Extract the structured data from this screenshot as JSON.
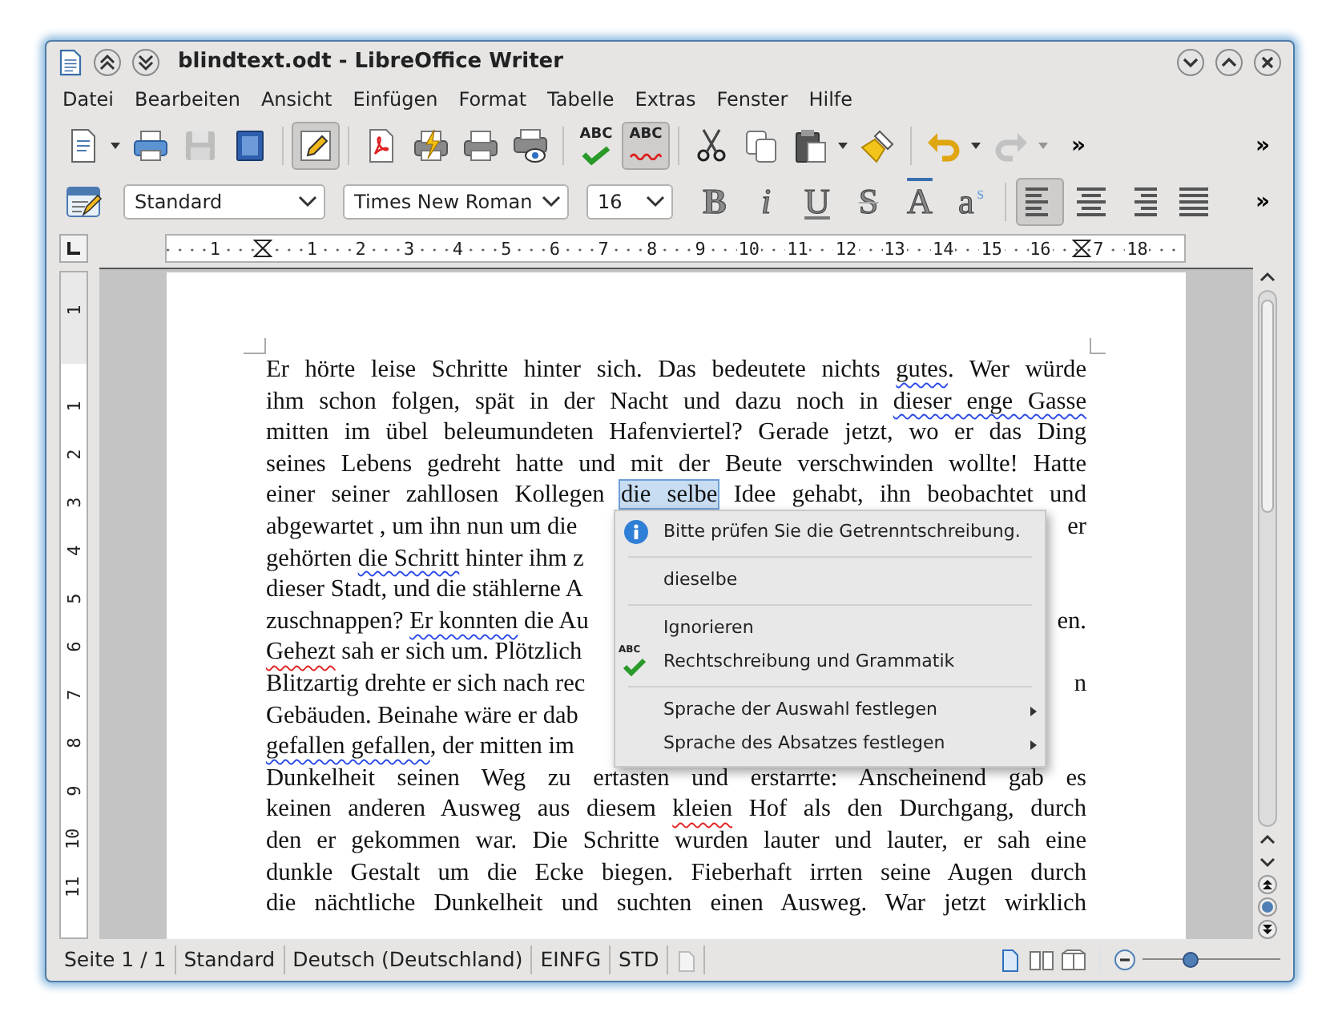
{
  "window": {
    "title": "blindtext.odt - LibreOffice Writer"
  },
  "menu": [
    "Datei",
    "Bearbeiten",
    "Ansicht",
    "Einfügen",
    "Format",
    "Tabelle",
    "Extras",
    "Fenster",
    "Hilfe"
  ],
  "toolbar": [
    {
      "kind": "new",
      "pressed": false,
      "disabled": false
    },
    {
      "kind": "dropdown",
      "pressed": false,
      "disabled": false
    },
    {
      "kind": "print",
      "pressed": false,
      "disabled": false
    },
    {
      "kind": "save",
      "pressed": false,
      "disabled": true
    },
    {
      "kind": "export",
      "pressed": false,
      "disabled": false
    },
    {
      "kind": "separator"
    },
    {
      "kind": "edit",
      "pressed": true,
      "disabled": false
    },
    {
      "kind": "separator"
    },
    {
      "kind": "pdf",
      "pressed": false,
      "disabled": false
    },
    {
      "kind": "print-direct",
      "pressed": false,
      "disabled": false
    },
    {
      "kind": "printer",
      "pressed": false,
      "disabled": false
    },
    {
      "kind": "preview",
      "pressed": false,
      "disabled": false
    },
    {
      "kind": "separator"
    },
    {
      "kind": "spellcheck",
      "label": "ABC",
      "disabled": false
    },
    {
      "kind": "autospell",
      "label": "ABC",
      "pressed": true,
      "disabled": false
    },
    {
      "kind": "separator"
    },
    {
      "kind": "cut",
      "pressed": false,
      "disabled": false
    },
    {
      "kind": "copy",
      "pressed": false,
      "disabled": false
    },
    {
      "kind": "paste",
      "pressed": false,
      "disabled": false
    },
    {
      "kind": "dropdown",
      "pressed": false,
      "disabled": false
    },
    {
      "kind": "clone",
      "pressed": false,
      "disabled": false
    },
    {
      "kind": "separator"
    },
    {
      "kind": "undo",
      "pressed": false,
      "disabled": false
    },
    {
      "kind": "dropdown",
      "pressed": false,
      "disabled": false
    },
    {
      "kind": "redo",
      "pressed": false,
      "disabled": true
    },
    {
      "kind": "dropdown",
      "pressed": false,
      "disabled": true
    },
    {
      "kind": "more",
      "label": "»",
      "pressed": false,
      "disabled": false
    }
  ],
  "toolbar_overflow": "»",
  "formatting": {
    "paragraph_style": "Standard",
    "font_name": "Times New Roman",
    "font_size": "16",
    "glyph_buttons": [
      {
        "glyph": "B",
        "pressed": false
      },
      {
        "glyph": "i",
        "pressed": false
      },
      {
        "glyph": "U",
        "pressed": false
      },
      {
        "glyph": "S",
        "pressed": false
      },
      {
        "glyph": "A",
        "pressed": false
      },
      {
        "glyph": "a$^{s}$",
        "pressed": false
      }
    ],
    "alignment": [
      {
        "kind": "left",
        "selected": true
      },
      {
        "kind": "center",
        "selected": false
      },
      {
        "kind": "right",
        "selected": false
      },
      {
        "kind": "justify",
        "selected": false
      }
    ],
    "overflow": "»"
  },
  "ruler": [
    {
      "kind": "number",
      "text": "1",
      "marker": false
    },
    {
      "kind": "indent"
    },
    {
      "kind": "number",
      "text": "1",
      "marker": false
    },
    {
      "kind": "number",
      "text": "2",
      "marker": false
    },
    {
      "kind": "number",
      "text": "3",
      "marker": false
    },
    {
      "kind": "number",
      "text": "4",
      "marker": false
    },
    {
      "kind": "number",
      "text": "5",
      "marker": false
    },
    {
      "kind": "number",
      "text": "6",
      "marker": false
    },
    {
      "kind": "number",
      "text": "7",
      "marker": false
    },
    {
      "kind": "number",
      "text": "8",
      "marker": false
    },
    {
      "kind": "number",
      "text": "9",
      "marker": false
    },
    {
      "kind": "number",
      "text": "10",
      "marker": false
    },
    {
      "kind": "number",
      "text": "11",
      "marker": false
    },
    {
      "kind": "number",
      "text": "12",
      "marker": false
    },
    {
      "kind": "number",
      "text": "13",
      "marker": false
    },
    {
      "kind": "number",
      "text": "14",
      "marker": false
    },
    {
      "kind": "number",
      "text": "15",
      "marker": false
    },
    {
      "kind": "number",
      "text": "16",
      "marker": false
    },
    {
      "kind": "number",
      "text": "7",
      "marker": true
    },
    {
      "kind": "number",
      "text": "18",
      "marker": false
    }
  ],
  "vertical_ruler": [
    "1",
    "1",
    "2",
    "3",
    "4",
    "5",
    "6",
    "7",
    "8",
    "9",
    "10",
    "11"
  ],
  "document": [
    {
      "covered": false,
      "left": [
        {
          "kind": "plain",
          "text": "Er hörte leise Schritte hinter sich. Das bedeutete nichts "
        },
        {
          "kind": "grammar",
          "text": "gutes"
        },
        {
          "kind": "plain",
          "text": ". Wer würde"
        }
      ]
    },
    {
      "covered": false,
      "left": [
        {
          "kind": "plain",
          "text": "ihm schon folgen, spät in der Nacht und dazu noch in "
        },
        {
          "kind": "grammar",
          "text": "dieser enge Gasse"
        }
      ]
    },
    {
      "covered": false,
      "left": [
        {
          "kind": "plain",
          "text": "mitten im übel beleumundeten  Hafenviertel? Gerade jetzt, wo er das Ding"
        }
      ]
    },
    {
      "covered": false,
      "left": [
        {
          "kind": "plain",
          "text": "seines Lebens gedreht hatte und mit der Beute verschwinden wollte! Hatte"
        }
      ]
    },
    {
      "covered": false,
      "left": [
        {
          "kind": "plain",
          "text": "einer seiner zahllosen Kollegen "
        },
        {
          "kind": "selected",
          "text": "die selbe"
        },
        {
          "kind": "plain",
          "text": " Idee gehabt, ihn beobachtet und"
        }
      ]
    },
    {
      "covered": true,
      "left": [
        {
          "kind": "plain",
          "text": "abgewartet , um ihn nun um die"
        }
      ],
      "right": [
        {
          "kind": "plain",
          "text": "er"
        }
      ]
    },
    {
      "covered": true,
      "left": [
        {
          "kind": "plain",
          "text": "gehörten "
        },
        {
          "kind": "grammar",
          "text": "die Schritt"
        },
        {
          "kind": "plain",
          "text": " hinter ihm z"
        }
      ]
    },
    {
      "covered": true,
      "left": [
        {
          "kind": "plain",
          "text": "dieser Stadt, und die stählerne A"
        }
      ]
    },
    {
      "covered": true,
      "left": [
        {
          "kind": "plain",
          "text": "zuschnappen? "
        },
        {
          "kind": "grammar",
          "text": "Er konnten"
        },
        {
          "kind": "plain",
          "text": " die Au"
        }
      ],
      "right": [
        {
          "kind": "plain",
          "text": "en."
        }
      ]
    },
    {
      "covered": true,
      "left": [
        {
          "kind": "spelling",
          "text": "Gehezt"
        },
        {
          "kind": "plain",
          "text": " sah er sich um. Plötzlich"
        }
      ]
    },
    {
      "covered": true,
      "left": [
        {
          "kind": "plain",
          "text": "Blitzartig drehte er sich nach rec"
        }
      ],
      "right": [
        {
          "kind": "plain",
          "text": "n"
        }
      ]
    },
    {
      "covered": true,
      "left": [
        {
          "kind": "plain",
          "text": "Gebäuden. Beinahe wäre er dab"
        }
      ]
    },
    {
      "covered": true,
      "left": [
        {
          "kind": "grammar",
          "text": "gefallen gefallen"
        },
        {
          "kind": "plain",
          "text": ", der mitten im"
        }
      ]
    },
    {
      "covered": false,
      "left": [
        {
          "kind": "plain",
          "text": "Dunkelheit seinen Weg zu ertasten und erstarrte: Anscheinend gab es"
        }
      ]
    },
    {
      "covered": false,
      "left": [
        {
          "kind": "plain",
          "text": "keinen anderen Ausweg aus diesem "
        },
        {
          "kind": "spelling",
          "text": "kleien"
        },
        {
          "kind": "plain",
          "text": " Hof als den Durchgang, durch"
        }
      ]
    },
    {
      "covered": false,
      "left": [
        {
          "kind": "plain",
          "text": "den er gekommen war. Die Schritte wurden lauter und lauter, er sah eine"
        }
      ]
    },
    {
      "covered": false,
      "left": [
        {
          "kind": "plain",
          "text": "dunkle Gestalt um die Ecke biegen. Fieberhaft irrten seine Augen durch"
        }
      ]
    },
    {
      "covered": false,
      "left": [
        {
          "kind": "plain",
          "text": "die nächtliche Dunkelheit und suchten einen Ausweg. War jetzt wirklich"
        }
      ]
    }
  ],
  "context_menu": [
    {
      "kind": "info",
      "text": "Bitte prüfen Sie die Getrenntschreibung."
    },
    {
      "kind": "separator"
    },
    {
      "kind": "suggestion",
      "text": "dieselbe"
    },
    {
      "kind": "separator"
    },
    {
      "kind": "action",
      "text": "Ignorieren"
    },
    {
      "kind": "action",
      "text": "Rechtschreibung und Grammatik",
      "icon_text": "ABC"
    },
    {
      "kind": "separator"
    },
    {
      "kind": "submenu",
      "text": "Sprache der Auswahl festlegen"
    },
    {
      "kind": "submenu",
      "text": "Sprache des Absatzes festlegen"
    }
  ],
  "status_bar": {
    "page": "Seite 1 / 1",
    "style": "Standard",
    "language": "Deutsch (Deutschland)",
    "insert_mode": "EINFG",
    "selection_mode": "STD",
    "views": [
      {
        "selected": true
      },
      {
        "selected": false
      },
      {
        "selected": false
      }
    ],
    "zoom": {
      "level": 0.35
    }
  }
}
